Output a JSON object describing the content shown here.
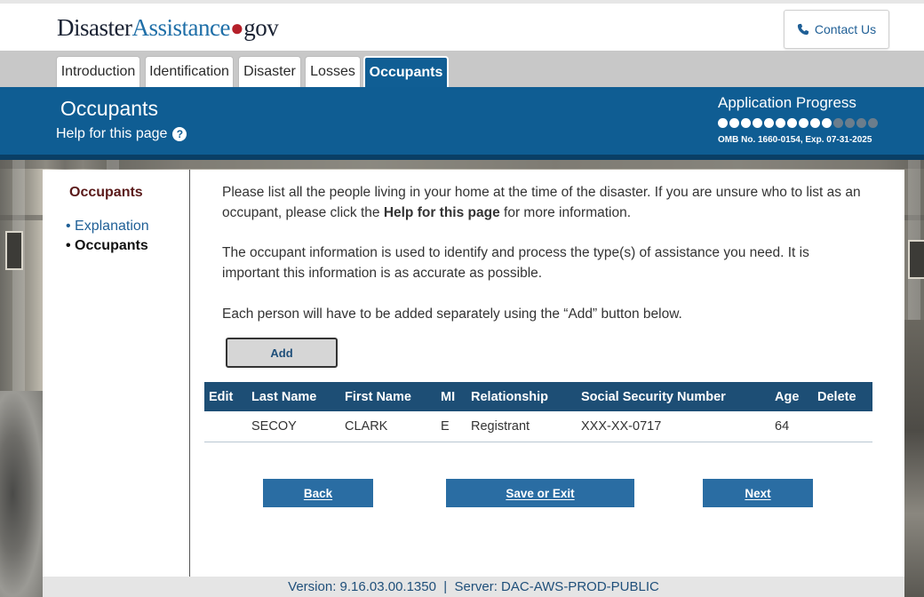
{
  "header": {
    "logo": {
      "part1": "Disaster",
      "part2": "Assistance",
      "dot": "●",
      "part3": "gov"
    },
    "contact_label": "Contact Us",
    "contact_icon": "phone-icon"
  },
  "tabs": [
    {
      "label": "Introduction",
      "active": false
    },
    {
      "label": "Identification",
      "active": false
    },
    {
      "label": "Disaster",
      "active": false
    },
    {
      "label": "Losses",
      "active": false
    },
    {
      "label": "Occupants",
      "active": true
    }
  ],
  "banner": {
    "title": "Occupants",
    "help_label": "Help for this page",
    "help_icon": "question-icon",
    "progress_label": "Application Progress",
    "progress": {
      "completed": 10,
      "total": 14
    },
    "omb": "OMB No. 1660-0154, Exp. 07-31-2025"
  },
  "sidenav": {
    "heading": "Occupants",
    "items": [
      {
        "label": "Explanation",
        "current": false
      },
      {
        "label": "Occupants",
        "current": true
      }
    ]
  },
  "main": {
    "para1_a": "Please list all the people living in your home at the time of the disaster. If you are unsure who to list as an occupant, please click the ",
    "para1_bold": "Help for this page",
    "para1_b": " for more information.",
    "para2": "The occupant information is used to identify and process the type(s) of assistance you need. It is important this information is as accurate as possible.",
    "para3": "Each person will have to be added separately using the “Add” button below.",
    "add_label": "Add"
  },
  "table": {
    "headers": [
      "Edit",
      "Last Name",
      "First Name",
      "MI",
      "Relationship",
      "Social Security Number",
      "Age",
      "Delete"
    ],
    "rows": [
      [
        "",
        "SECOY",
        "CLARK",
        "E",
        "Registrant",
        "XXX-XX-0717",
        "64",
        ""
      ]
    ]
  },
  "buttons": {
    "back": {
      "hotkey": "B",
      "rest": "ack"
    },
    "save": {
      "hotkey": "S",
      "rest": "ave or Exit"
    },
    "next": {
      "hotkey": "N",
      "rest": "ext"
    }
  },
  "footer": "Version: 9.16.03.00.1350  |  Server: DAC-AWS-PROD-PUBLIC",
  "colors": {
    "brand_blue": "#0f5d93",
    "table_header": "#1d4e75",
    "button_blue": "#2a6da3",
    "logo_red": "#b5202a"
  }
}
